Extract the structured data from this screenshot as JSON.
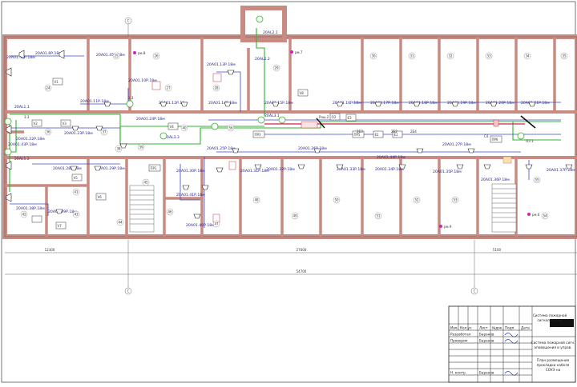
{
  "drawing": {
    "dimensions": {
      "overall": "54700",
      "left": "12300",
      "middle": "27000",
      "right": "5100"
    },
    "axis_labels": [
      "С",
      "С",
      "С"
    ],
    "panel_labels": [
      "20AL1.1",
      "20AL2.1",
      "20AL2.2",
      "20AL3.1",
      "20AL3.3",
      "20AL1.2"
    ],
    "cable_labels": [
      "20A01.8Р.18м",
      "20A01.10Р.18м",
      "20A01.11Р.18м",
      "20A01.12Р.18м",
      "20A01.13Р.18м",
      "20A01.14Р.18м",
      "20A01.15Р.18м",
      "20A01.16Р.18м",
      "20A01.17Р.18м",
      "20A01.18Р.18м",
      "20A01.19Р.18м",
      "20A01.20Р.18м",
      "20A01.21Р.18м",
      "20A01.22Р.18м",
      "20A01.23Р.18м",
      "20A01.24Р.18м",
      "20A01.25Р.18м",
      "20A01.26Р.18м",
      "20A01.27Р.18м",
      "20A01.28Р.18м",
      "20A01.29Р.18м",
      "20A01.30Р.18м",
      "20A01.31Р.18м",
      "20A01.32Р.18м",
      "20A01.33Р.18м",
      "20A01.34Р.18м",
      "20A01.35Р.18м",
      "20A01.36Р.18м",
      "20A01.37Р.18м",
      "20A01.38Р.18м",
      "20A01.39Р.18м",
      "20A01.40Р.18м",
      "20A01.41Р.18м",
      "20A01.42Р.18м",
      "20A01.43Р.18м",
      "20A01.44Р.18м",
      "20A01.45Р.18м"
    ],
    "device_codes": [
      "V1",
      "V2",
      "V3",
      "V4",
      "V5",
      "V6",
      "V7",
      "V8",
      "ПР1",
      "ПРЗ",
      "ПР5",
      "ПР6",
      "ЕЗ",
      "Е2",
      "Е1",
      "2Б2",
      "2Б3",
      "2Б4",
      "Раш.2",
      "ОЗ",
      "ОЗ.1",
      "3.3",
      "С4",
      "1.3"
    ],
    "markers": [
      "рм.7",
      "рм.8",
      "рм.9",
      "рм.6"
    ],
    "room_numbers": [
      "24",
      "25",
      "26",
      "27",
      "28",
      "29",
      "30",
      "31",
      "32",
      "33",
      "34",
      "35",
      "36",
      "37",
      "38",
      "39",
      "40",
      "41",
      "42",
      "43",
      "44",
      "45",
      "46",
      "47",
      "48",
      "49",
      "50",
      "51",
      "52",
      "53",
      "54",
      "55",
      "56"
    ]
  },
  "title_block": {
    "title_lines": [
      "Система пожарной",
      "сигнализации"
    ],
    "desc_lines": [
      "Система пожарной сигн.",
      "оповещения и управ."
    ],
    "plan_lines": [
      "План размещения",
      "прокладки кабеля",
      "СОУЭ на"
    ],
    "headers": [
      "Изм.",
      "Кол.уч",
      "Лист",
      "№док.",
      "Подп.",
      "Дата"
    ],
    "rows": [
      {
        "role": "Разработал",
        "name": "Баранов"
      },
      {
        "role": "Проверил",
        "name": "Баранов"
      },
      {
        "role": "Н. контр.",
        "name": "Баранов"
      }
    ]
  }
}
